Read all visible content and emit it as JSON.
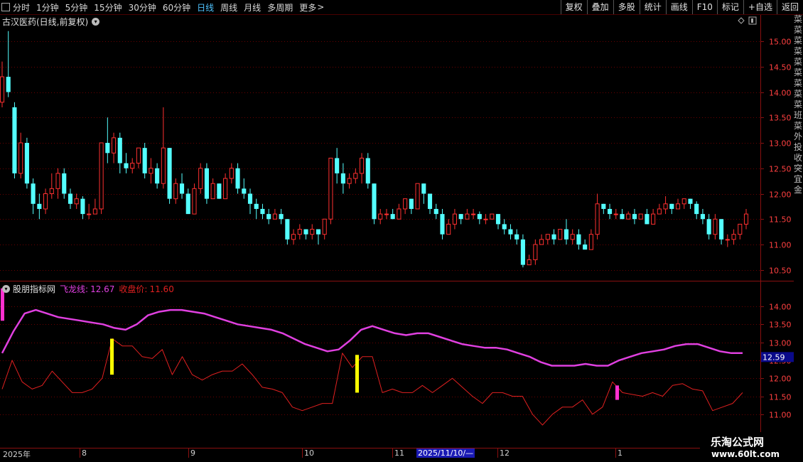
{
  "toolbar": {
    "periods": [
      {
        "label": "分时",
        "active": false
      },
      {
        "label": "1分钟",
        "active": false
      },
      {
        "label": "5分钟",
        "active": false
      },
      {
        "label": "15分钟",
        "active": false
      },
      {
        "label": "30分钟",
        "active": false
      },
      {
        "label": "60分钟",
        "active": false
      },
      {
        "label": "日线",
        "active": true
      },
      {
        "label": "周线",
        "active": false
      },
      {
        "label": "月线",
        "active": false
      },
      {
        "label": "多周期",
        "active": false
      },
      {
        "label": "更多",
        "active": false
      }
    ],
    "more_arrow": ">",
    "actions": [
      "复权",
      "叠加",
      "多股",
      "统计",
      "画线",
      "F10",
      "标记",
      "+自选",
      "返回"
    ]
  },
  "main_chart": {
    "title": "古汉医药(日线,前复权)",
    "y_ticks": [
      "15.00",
      "14.50",
      "14.00",
      "13.50",
      "13.00",
      "12.50",
      "12.00",
      "11.50",
      "11.00",
      "10.50"
    ]
  },
  "indicator": {
    "name": "股朋指标网",
    "feilong_label": "飞龙线:",
    "feilong_value": "12.67",
    "close_label": "收盘价:",
    "close_value": "11.60",
    "y_ticks": [
      "14.00",
      "13.50",
      "13.00",
      "12.50",
      "12.00",
      "11.50",
      "11.00"
    ],
    "current_tag": "12.59"
  },
  "date_axis": {
    "labels": [
      "2025年",
      "8",
      "9",
      "10",
      "11",
      "12",
      "1"
    ],
    "cursor_label": "2025/11/10/—"
  },
  "right_strip_text": "菜菜菜菜菜菜菜菜菜班菜外投收突宜金",
  "watermark": {
    "title": "乐淘公式网",
    "url": "www.60lt.com"
  },
  "colors": {
    "up": "#ff3030",
    "down": "#54ffff",
    "feilong": "#e040e0",
    "close_line": "#e02020",
    "active": "#4fc3ff",
    "signal_yellow": "#ffff00",
    "signal_magenta": "#ff30d0"
  },
  "chart_data": [
    {
      "type": "candlestick",
      "title": "古汉医药(日线,前复权)",
      "ylim": [
        10.3,
        15.2
      ],
      "candles": [
        [
          13.8,
          14.3,
          13.7,
          14.6
        ],
        [
          14.3,
          14.0,
          13.9,
          15.2
        ],
        [
          13.7,
          12.4,
          12.3,
          13.8
        ],
        [
          12.4,
          13.0,
          12.3,
          13.2
        ],
        [
          13.0,
          12.2,
          12.1,
          13.1
        ],
        [
          12.2,
          11.8,
          11.6,
          12.3
        ],
        [
          11.8,
          11.7,
          11.5,
          12.0
        ],
        [
          11.7,
          12.0,
          11.6,
          12.1
        ],
        [
          12.0,
          12.1,
          11.9,
          12.4
        ],
        [
          12.1,
          12.4,
          11.9,
          12.5
        ],
        [
          12.4,
          12.0,
          11.9,
          12.5
        ],
        [
          12.0,
          11.8,
          11.7,
          12.1
        ],
        [
          11.8,
          11.9,
          11.7,
          12.0
        ],
        [
          11.9,
          11.6,
          11.5,
          11.95
        ],
        [
          11.6,
          11.6,
          11.5,
          11.8
        ],
        [
          11.6,
          11.7,
          11.6,
          11.9
        ],
        [
          11.7,
          13.0,
          11.6,
          13.0
        ],
        [
          13.0,
          12.8,
          12.6,
          13.5
        ],
        [
          12.8,
          13.1,
          12.6,
          13.2
        ],
        [
          13.1,
          12.6,
          12.4,
          13.2
        ],
        [
          12.6,
          12.5,
          12.4,
          12.8
        ],
        [
          12.5,
          12.6,
          12.4,
          12.7
        ],
        [
          12.6,
          12.9,
          12.5,
          12.9
        ],
        [
          12.9,
          12.4,
          12.3,
          13.0
        ],
        [
          12.4,
          12.5,
          12.2,
          12.7
        ],
        [
          12.5,
          12.2,
          12.1,
          12.6
        ],
        [
          12.2,
          12.9,
          12.1,
          13.7
        ],
        [
          12.9,
          11.9,
          11.8,
          12.9
        ],
        [
          11.9,
          12.2,
          11.8,
          12.3
        ],
        [
          12.2,
          12.0,
          11.9,
          12.4
        ],
        [
          12.0,
          11.6,
          11.6,
          12.1
        ],
        [
          11.6,
          12.1,
          11.6,
          12.2
        ],
        [
          12.1,
          12.5,
          12.0,
          12.6
        ],
        [
          12.5,
          11.9,
          11.8,
          12.6
        ],
        [
          11.9,
          12.2,
          11.9,
          12.3
        ],
        [
          12.2,
          11.9,
          11.9,
          12.2
        ],
        [
          11.9,
          12.3,
          11.9,
          12.4
        ],
        [
          12.3,
          12.5,
          12.2,
          12.6
        ],
        [
          12.5,
          12.1,
          12.0,
          12.6
        ],
        [
          12.1,
          12.0,
          11.9,
          12.3
        ],
        [
          12.0,
          11.8,
          11.6,
          12.1
        ],
        [
          11.8,
          11.7,
          11.5,
          11.9
        ],
        [
          11.7,
          11.6,
          11.5,
          11.8
        ],
        [
          11.6,
          11.5,
          11.4,
          11.7
        ],
        [
          11.5,
          11.6,
          11.5,
          11.7
        ],
        [
          11.6,
          11.5,
          11.4,
          11.7
        ],
        [
          11.5,
          11.1,
          11.0,
          11.5
        ],
        [
          11.1,
          11.2,
          11.0,
          11.3
        ],
        [
          11.2,
          11.3,
          11.1,
          11.4
        ],
        [
          11.3,
          11.2,
          11.1,
          11.3
        ],
        [
          11.2,
          11.3,
          11.1,
          11.4
        ],
        [
          11.3,
          11.2,
          11.0,
          11.3
        ],
        [
          11.2,
          11.5,
          11.1,
          11.5
        ],
        [
          11.5,
          12.7,
          11.4,
          12.7
        ],
        [
          12.7,
          12.4,
          12.2,
          12.9
        ],
        [
          12.4,
          12.2,
          12.0,
          12.6
        ],
        [
          12.2,
          12.3,
          12.1,
          12.4
        ],
        [
          12.3,
          12.4,
          12.2,
          12.5
        ],
        [
          12.4,
          12.7,
          12.2,
          12.8
        ],
        [
          12.7,
          12.2,
          12.1,
          12.8
        ],
        [
          12.2,
          11.5,
          11.4,
          12.2
        ],
        [
          11.5,
          11.6,
          11.4,
          11.7
        ],
        [
          11.6,
          11.6,
          11.5,
          11.7
        ],
        [
          11.6,
          11.5,
          11.5,
          11.7
        ],
        [
          11.5,
          11.7,
          11.5,
          11.8
        ],
        [
          11.7,
          11.9,
          11.6,
          11.9
        ],
        [
          11.9,
          11.7,
          11.6,
          11.9
        ],
        [
          11.7,
          12.2,
          11.7,
          12.2
        ],
        [
          12.2,
          12.0,
          11.8,
          12.2
        ],
        [
          12.0,
          11.7,
          11.6,
          12.0
        ],
        [
          11.7,
          11.6,
          11.5,
          11.8
        ],
        [
          11.6,
          11.2,
          11.1,
          11.7
        ],
        [
          11.2,
          11.4,
          11.2,
          11.5
        ],
        [
          11.4,
          11.6,
          11.3,
          11.7
        ],
        [
          11.6,
          11.5,
          11.4,
          11.6
        ],
        [
          11.5,
          11.6,
          11.5,
          11.7
        ],
        [
          11.6,
          11.6,
          11.5,
          11.7
        ],
        [
          11.6,
          11.5,
          11.4,
          11.65
        ],
        [
          11.5,
          11.5,
          11.4,
          11.6
        ],
        [
          11.5,
          11.6,
          11.5,
          11.6
        ],
        [
          11.6,
          11.4,
          11.3,
          11.6
        ],
        [
          11.4,
          11.3,
          11.2,
          11.5
        ],
        [
          11.3,
          11.2,
          11.1,
          11.4
        ],
        [
          11.2,
          11.1,
          11.0,
          11.3
        ],
        [
          11.1,
          10.6,
          10.55,
          11.2
        ],
        [
          10.6,
          10.7,
          10.6,
          10.8
        ],
        [
          10.7,
          11.0,
          10.6,
          11.1
        ],
        [
          11.0,
          11.1,
          11.0,
          11.2
        ],
        [
          11.1,
          11.2,
          11.0,
          11.2
        ],
        [
          11.2,
          11.1,
          11.0,
          11.3
        ],
        [
          11.1,
          11.3,
          11.1,
          11.3
        ],
        [
          11.3,
          11.1,
          11.0,
          11.5
        ],
        [
          11.1,
          11.2,
          11.0,
          11.3
        ],
        [
          11.2,
          11.0,
          10.9,
          11.3
        ],
        [
          11.0,
          10.9,
          10.9,
          11.1
        ],
        [
          10.9,
          11.2,
          10.9,
          11.3
        ],
        [
          11.2,
          11.8,
          11.1,
          12.0
        ],
        [
          11.8,
          11.7,
          11.6,
          11.8
        ],
        [
          11.7,
          11.6,
          11.5,
          11.8
        ],
        [
          11.6,
          11.6,
          11.5,
          11.7
        ],
        [
          11.6,
          11.5,
          11.5,
          11.7
        ],
        [
          11.5,
          11.6,
          11.5,
          11.65
        ],
        [
          11.6,
          11.5,
          11.4,
          11.7
        ],
        [
          11.5,
          11.6,
          11.5,
          11.6
        ],
        [
          11.6,
          11.4,
          11.4,
          11.7
        ],
        [
          11.4,
          11.6,
          11.4,
          11.7
        ],
        [
          11.6,
          11.7,
          11.6,
          11.8
        ],
        [
          11.7,
          11.8,
          11.6,
          11.95
        ],
        [
          11.8,
          11.7,
          11.6,
          11.8
        ],
        [
          11.7,
          11.8,
          11.7,
          11.9
        ],
        [
          11.8,
          11.9,
          11.7,
          11.9
        ],
        [
          11.9,
          11.8,
          11.7,
          11.9
        ],
        [
          11.8,
          11.6,
          11.5,
          11.85
        ],
        [
          11.6,
          11.5,
          11.4,
          11.7
        ],
        [
          11.5,
          11.2,
          11.1,
          11.6
        ],
        [
          11.2,
          11.5,
          11.1,
          11.6
        ],
        [
          11.5,
          11.1,
          11.0,
          11.5
        ],
        [
          11.1,
          11.1,
          10.95,
          11.2
        ],
        [
          11.1,
          11.2,
          11.0,
          11.3
        ],
        [
          11.2,
          11.4,
          11.1,
          11.4
        ],
        [
          11.4,
          11.6,
          11.3,
          11.7
        ]
      ]
    },
    {
      "type": "line",
      "series": [
        {
          "name": "飞龙线",
          "values": [
            12.7,
            13.3,
            13.8,
            13.9,
            13.8,
            13.7,
            13.65,
            13.6,
            13.55,
            13.5,
            13.4,
            13.35,
            13.5,
            13.75,
            13.85,
            13.9,
            13.9,
            13.85,
            13.8,
            13.7,
            13.6,
            13.5,
            13.45,
            13.4,
            13.35,
            13.25,
            13.1,
            12.95,
            12.85,
            12.75,
            12.8,
            13.05,
            13.35,
            13.45,
            13.35,
            13.25,
            13.2,
            13.25,
            13.25,
            13.15,
            13.05,
            12.95,
            12.9,
            12.85,
            12.85,
            12.8,
            12.7,
            12.6,
            12.45,
            12.35,
            12.35,
            12.35,
            12.4,
            12.35,
            12.35,
            12.5,
            12.6,
            12.7,
            12.75,
            12.8,
            12.9,
            12.95,
            12.95,
            12.85,
            12.75,
            12.7,
            12.7
          ]
        },
        {
          "name": "收盘价",
          "values": [
            11.7,
            12.5,
            11.9,
            11.7,
            11.8,
            12.2,
            11.9,
            11.6,
            11.6,
            11.7,
            12.0,
            13.1,
            12.9,
            12.9,
            12.6,
            12.55,
            12.8,
            12.1,
            12.6,
            12.1,
            11.95,
            12.1,
            12.2,
            12.2,
            12.4,
            12.1,
            11.75,
            11.7,
            11.6,
            11.2,
            11.1,
            11.2,
            11.3,
            11.3,
            12.7,
            12.3,
            12.6,
            12.6,
            11.6,
            11.7,
            11.6,
            11.6,
            11.8,
            11.6,
            11.8,
            12.0,
            11.75,
            11.5,
            11.3,
            11.6,
            11.6,
            11.5,
            11.5,
            11.0,
            10.7,
            11.0,
            11.2,
            11.2,
            11.4,
            11.0,
            11.2,
            11.9,
            11.6,
            11.55,
            11.5,
            11.6,
            11.5,
            11.8,
            11.85,
            11.7,
            11.65,
            11.1,
            11.2,
            11.3,
            11.6
          ]
        }
      ],
      "signals": [
        {
          "color": "magenta",
          "top": 14.5,
          "bottom": 13.6
        },
        {
          "color": "yellow",
          "top": 13.1,
          "bottom": 12.1
        },
        {
          "color": "yellow",
          "top": 12.65,
          "bottom": 11.6
        },
        {
          "color": "magenta",
          "top": 11.8,
          "bottom": 11.4
        }
      ],
      "ylim": [
        10.4,
        14.75
      ]
    }
  ]
}
